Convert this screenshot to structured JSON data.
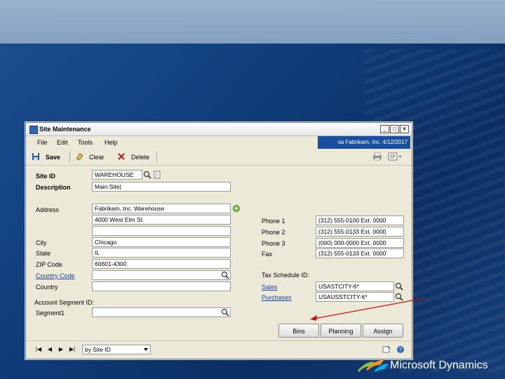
{
  "window": {
    "title": "Site Maintenance",
    "controls": {
      "minimize": "_",
      "maximize": "□",
      "close": "×"
    }
  },
  "menu": [
    "File",
    "Edit",
    "Tools",
    "Help"
  ],
  "company_info": "sa  Fabrikam, Inc.  4/12/2017",
  "toolbar": {
    "save": "Save",
    "clear": "Clear",
    "delete": "Delete"
  },
  "form": {
    "site_id": {
      "label": "Site ID",
      "value": "WAREHOUSE"
    },
    "description": {
      "label": "Description",
      "value": "Main Site|"
    },
    "address": {
      "label": "Address",
      "lines": [
        "Fabrikam, Inc. Warehouse",
        "4000 West Elm St.",
        ""
      ]
    },
    "city": {
      "label": "City",
      "value": "Chicago"
    },
    "state": {
      "label": "State",
      "value": "IL"
    },
    "zip": {
      "label": "ZIP Code",
      "value": "60601-4300"
    },
    "country_code": {
      "label": "Country Code",
      "value": ""
    },
    "country": {
      "label": "Country",
      "value": ""
    },
    "account_segment_id": {
      "label": "Account Segment ID:"
    },
    "segment1": {
      "label": "Segment1",
      "value": ""
    },
    "phone1": {
      "label": "Phone 1",
      "value": "(312) 555-0100 Ext. 0000"
    },
    "phone2": {
      "label": "Phone 2",
      "value": "(312) 555-0133 Ext. 0000"
    },
    "phone3": {
      "label": "Phone 3",
      "value": "(000) 000-0000 Ext. 0000"
    },
    "fax": {
      "label": "Fax",
      "value": "(312) 555-0133 Ext. 0000"
    },
    "tax_schedule": {
      "label": "Tax Schedule ID:"
    },
    "sales": {
      "label": "Sales",
      "value": "USASTCITY-6*"
    },
    "purchases": {
      "label": "Purchases",
      "value": "USAUSSTCITY-6*"
    }
  },
  "buttons": {
    "bins": "Bins",
    "planning": "Planning",
    "assign": "Assign"
  },
  "status": {
    "sort_value": "by Site ID",
    "nav": [
      "|◀",
      "◀",
      "▶",
      "▶|"
    ]
  },
  "brand": {
    "text": "Microsoft Dynamics"
  }
}
